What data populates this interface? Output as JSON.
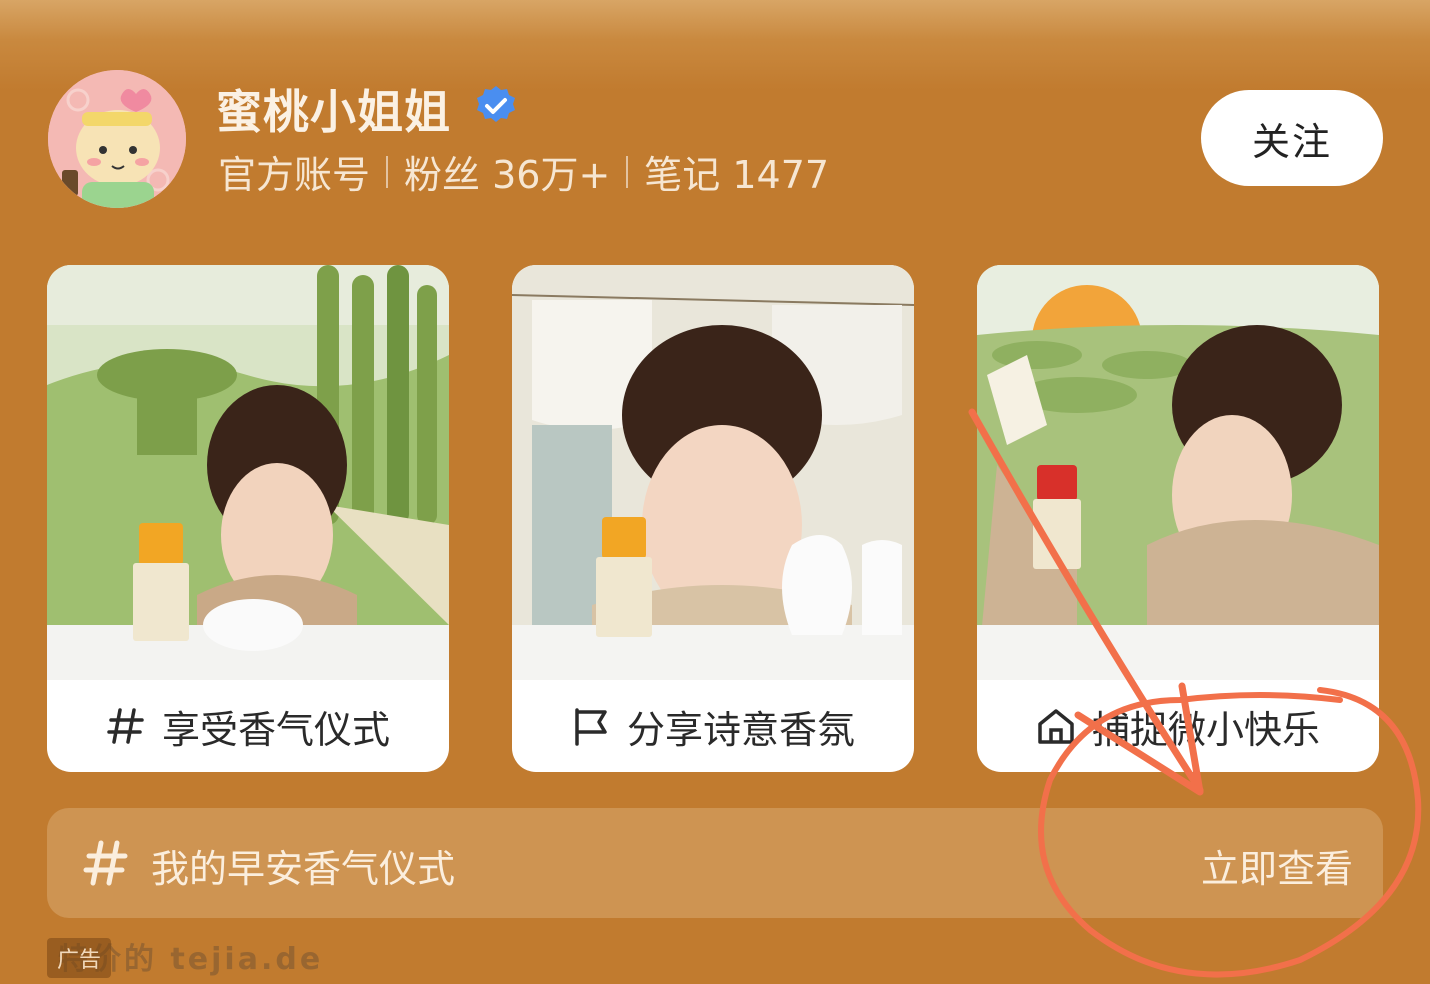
{
  "account": {
    "name": "蜜桃小姐姐",
    "type": "官方账号",
    "fans": "粉丝 36万+",
    "notes": "笔记 1477",
    "follow_label": "关注"
  },
  "cards": [
    {
      "icon": "hashtag-icon",
      "label": "享受香气仪式"
    },
    {
      "icon": "flag-icon",
      "label": "分享诗意香氛"
    },
    {
      "icon": "home-icon",
      "label": "捕捉微小快乐"
    }
  ],
  "topic_bar": {
    "icon": "hashtag-icon",
    "topic": "我的早安香气仪式",
    "action": "立即查看"
  },
  "ad_label": "广告",
  "watermark": "特价的 tejia.de",
  "colors": {
    "background": "#c17b2f",
    "annotation": "#f2704a",
    "verified": "#4a8ef0"
  }
}
